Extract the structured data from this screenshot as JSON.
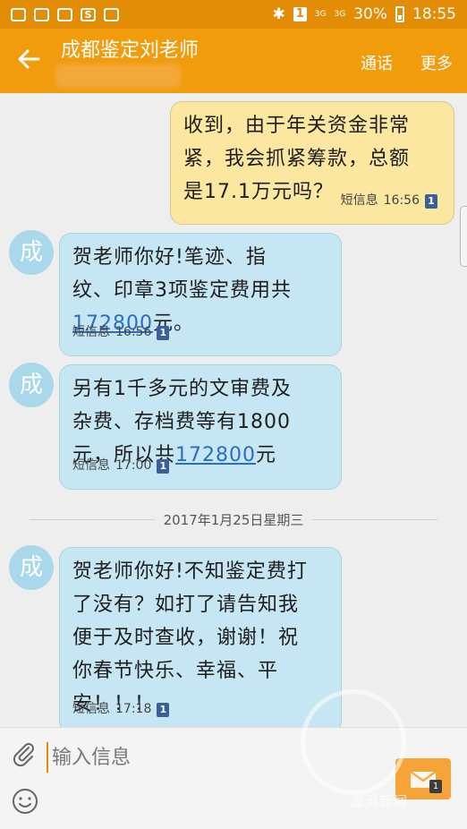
{
  "status_bar": {
    "battery": "30%",
    "time": "18:55",
    "sim": "1",
    "network_a": "3G",
    "network_b": "3G"
  },
  "header": {
    "contact_name": "成都鉴定刘老师",
    "back_icon": "back-arrow-icon",
    "call_label": "通话",
    "more_label": "更多"
  },
  "messages": [
    {
      "direction": "sent",
      "text": "收到，由于年关资金非常\n紧，我会抓紧筹款，总额\n是17.1万元吗？",
      "service": "短信息",
      "time": "16:56",
      "sim": "1"
    },
    {
      "direction": "received",
      "avatar": "成",
      "text_before": "贺老师你好!笔迹、指\n纹、印章3项鉴定费用共\n",
      "link": "172800",
      "text_after": "元。",
      "service": "短信息",
      "time": "16:56",
      "sim": "1"
    },
    {
      "direction": "received",
      "avatar": "成",
      "text_before": "另有1千多元的文审费及\n杂费、存档费等有1800\n元，所以共",
      "link": "172800",
      "text_after": "元",
      "service": "短信息",
      "time": "17:00",
      "sim": "1"
    },
    {
      "direction": "received",
      "avatar": "成",
      "text": "贺老师你好!不知鉴定费打\n了没有？如打了请告知我\n便于及时查收，谢谢！祝\n你春节快乐、幸福、平\n安！！！",
      "service": "短信息",
      "time": "17:18",
      "sim": "1"
    }
  ],
  "date_separator": "2017年1月25日星期三",
  "input": {
    "placeholder": "输入信息",
    "attach_icon": "paperclip-icon",
    "emoji_icon": "emoji-icon",
    "send_icon": "send-envelope-icon",
    "send_sim": "1"
  },
  "watermark": "澎湃新闻",
  "colors": {
    "status_bar": "#e38c06",
    "app_bar": "#f19c0c",
    "sent_bubble": "#fbe7a0",
    "received_bubble": "#c6e6f3",
    "avatar": "#a9d8ea",
    "link": "#2a6ebf",
    "send_button": "#f6a43a"
  }
}
